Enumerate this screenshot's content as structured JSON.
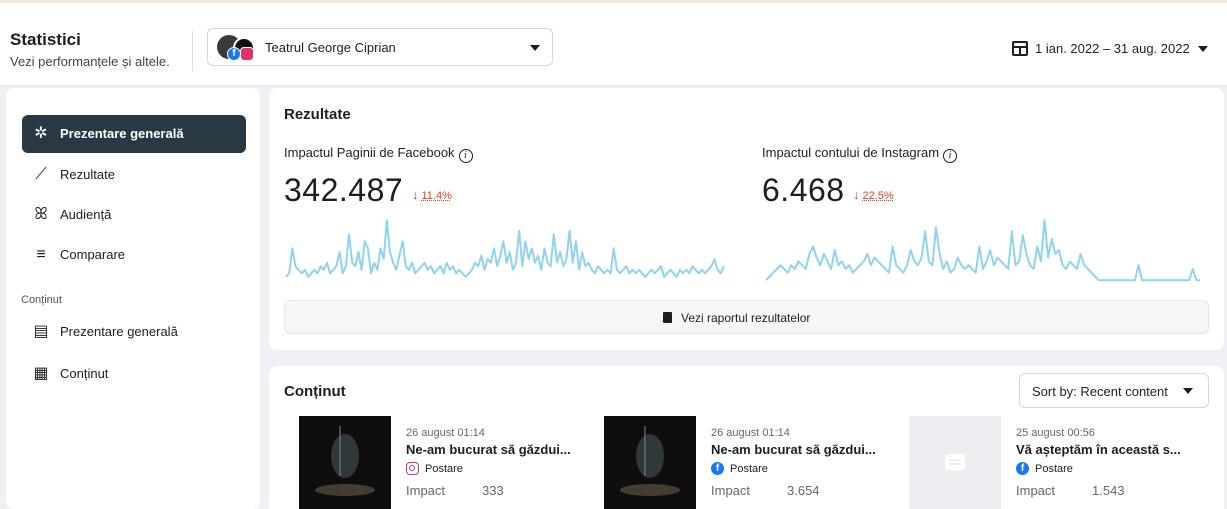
{
  "colors": {
    "accent": "#283943",
    "sparkline": "#8fd3ee",
    "negative": "#e0411f",
    "facebook": "#1877f2",
    "instagram": "#c13584"
  },
  "header": {
    "title": "Statistici",
    "subtitle": "Vezi performanțele și altele.",
    "account": {
      "name": "Teatrul George Ciprian",
      "icons": [
        "facebook-icon",
        "instagram-icon"
      ]
    },
    "date_range": "1 ian. 2022 – 31 aug. 2022"
  },
  "sidebar": {
    "items": [
      {
        "label": "Prezentare generală",
        "icon": "overview-icon",
        "active": true
      },
      {
        "label": "Rezultate",
        "icon": "trend-icon",
        "active": false
      },
      {
        "label": "Audiență",
        "icon": "audience-icon",
        "active": false
      },
      {
        "label": "Comparare",
        "icon": "compare-icon",
        "active": false
      }
    ],
    "section_label": "Conținut",
    "content_items": [
      {
        "label": "Prezentare generală",
        "icon": "content-overview-icon"
      },
      {
        "label": "Conținut",
        "icon": "table-icon"
      }
    ]
  },
  "results": {
    "title": "Rezultate",
    "facebook": {
      "label": "Impactul Paginii de Facebook",
      "value": "342.487",
      "delta": "11.4%",
      "series": [
        2,
        3,
        10,
        5,
        4,
        3,
        4,
        2,
        3,
        4,
        3,
        5,
        4,
        6,
        3,
        4,
        5,
        9,
        3,
        5,
        14,
        6,
        5,
        9,
        4,
        12,
        10,
        3,
        6,
        4,
        10,
        7,
        18,
        9,
        6,
        4,
        8,
        12,
        5,
        4,
        6,
        3,
        4,
        5,
        6,
        4,
        5,
        3,
        4,
        5,
        3,
        6,
        4,
        5,
        3,
        4,
        3,
        2,
        3,
        4,
        6,
        5,
        8,
        4,
        7,
        6,
        10,
        5,
        8,
        12,
        6,
        9,
        4,
        6,
        15,
        5,
        12,
        7,
        10,
        6,
        8,
        4,
        10,
        6,
        5,
        14,
        6,
        9,
        5,
        7,
        15,
        6,
        12,
        4,
        9,
        5,
        6,
        4,
        3,
        5,
        4,
        3,
        4,
        3,
        10,
        4,
        3,
        4,
        5,
        3,
        4,
        3,
        4,
        3,
        2,
        3,
        4,
        3,
        4,
        5,
        2,
        3,
        4,
        3,
        2,
        4,
        3,
        4,
        3,
        5,
        4,
        3,
        4,
        3,
        4,
        5,
        7,
        4,
        3,
        5
      ]
    },
    "instagram": {
      "label": "Impactul contului de Instagram",
      "value": "6.468",
      "delta": "22.5%",
      "series": [
        1,
        2,
        3,
        4,
        5,
        4,
        3,
        5,
        4,
        6,
        5,
        4,
        8,
        10,
        7,
        5,
        8,
        6,
        4,
        9,
        5,
        6,
        4,
        5,
        3,
        4,
        5,
        6,
        8,
        5,
        7,
        6,
        5,
        4,
        3,
        10,
        5,
        4,
        3,
        5,
        9,
        6,
        5,
        7,
        14,
        6,
        5,
        15,
        8,
        4,
        6,
        3,
        4,
        7,
        5,
        4,
        5,
        4,
        3,
        10,
        4,
        6,
        9,
        5,
        7,
        6,
        5,
        4,
        14,
        5,
        6,
        13,
        8,
        5,
        4,
        10,
        6,
        17,
        7,
        12,
        8,
        9,
        5,
        4,
        6,
        5,
        4,
        8,
        5,
        4,
        3,
        2,
        1,
        1,
        1,
        1,
        1,
        1,
        1,
        1,
        1,
        1,
        1,
        5,
        1,
        1,
        1,
        1,
        1,
        1,
        1,
        1,
        1,
        1,
        1,
        1,
        1,
        1,
        4,
        1,
        1
      ]
    },
    "report_button": "Vezi raportul rezultatelor"
  },
  "content": {
    "title": "Conținut",
    "sort_label": "Sort by: Recent content",
    "posts": [
      {
        "date": "26 august 01:14",
        "title": "Ne-am bucurat să găzdui...",
        "type": "Postare",
        "platform": "instagram",
        "impact_label": "Impact",
        "impact": "333"
      },
      {
        "date": "26 august 01:14",
        "title": "Ne-am bucurat să găzdui...",
        "type": "Postare",
        "platform": "facebook",
        "impact_label": "Impact",
        "impact": "3.654"
      },
      {
        "date": "25 august 00:56",
        "title": "Vă așteptăm în această s...",
        "type": "Postare",
        "platform": "facebook",
        "impact_label": "Impact",
        "impact": "1.543"
      }
    ]
  }
}
